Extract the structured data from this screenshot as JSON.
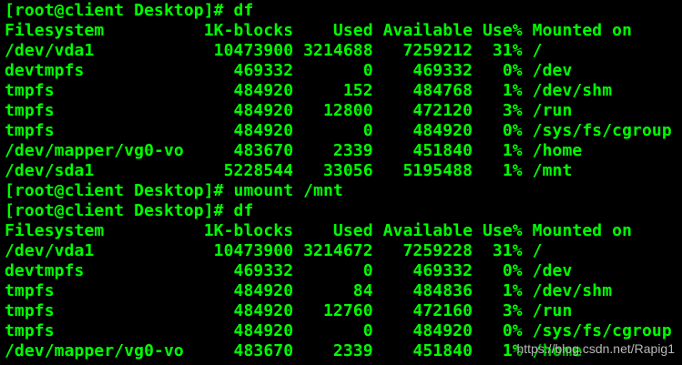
{
  "terminal": {
    "lines": [
      "[root@client Desktop]# df",
      "Filesystem          1K-blocks    Used Available Use% Mounted on",
      "/dev/vda1            10473900 3214688   7259212  31% /",
      "devtmpfs               469332       0    469332   0% /dev",
      "tmpfs                  484920     152    484768   1% /dev/shm",
      "tmpfs                  484920   12800    472120   3% /run",
      "tmpfs                  484920       0    484920   0% /sys/fs/cgroup",
      "/dev/mapper/vg0-vo     483670    2339    451840   1% /home",
      "/dev/sda1             5228544   33056   5195488   1% /mnt",
      "[root@client Desktop]# umount /mnt",
      "[root@client Desktop]# df",
      "Filesystem          1K-blocks    Used Available Use% Mounted on",
      "/dev/vda1            10473900 3214672   7259228  31% /",
      "devtmpfs               469332       0    469332   0% /dev",
      "tmpfs                  484920      84    484836   1% /dev/shm",
      "tmpfs                  484920   12760    472160   3% /run",
      "tmpfs                  484920       0    484920   0% /sys/fs/cgroup",
      "/dev/mapper/vg0-vo     483670    2339    451840   1% /home"
    ],
    "watermark": "https://blog.csdn.net/Rapig1",
    "colors": {
      "background": "#000000",
      "text": "#00ff00"
    }
  }
}
